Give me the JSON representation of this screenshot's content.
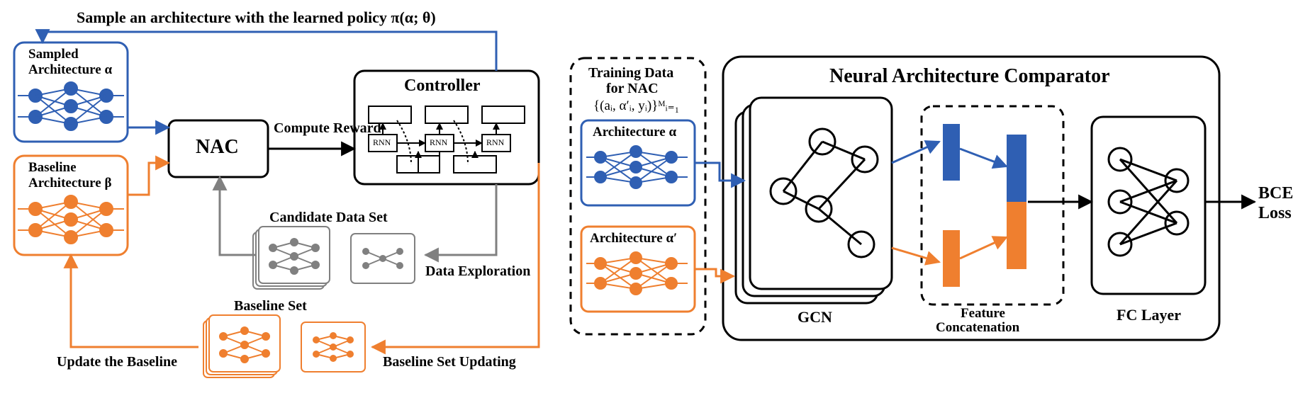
{
  "left": {
    "top_caption": "Sample an architecture with the learned policy π(α; θ)",
    "sampled_box_l1": "Sampled",
    "sampled_box_l2": "Architecture α",
    "baseline_box_l1": "Baseline",
    "baseline_box_l2": "Architecture β",
    "nac_label": "NAC",
    "compute_reward": "Compute Reward",
    "controller_title": "Controller",
    "rnn": "RNN",
    "candidate_title": "Candidate Data Set",
    "data_exploration": "Data Exploration",
    "baseline_set_title": "Baseline Set",
    "baseline_set_updating": "Baseline Set Updating",
    "update_baseline": "Update the Baseline"
  },
  "right": {
    "training_data_l1": "Training Data",
    "training_data_l2": "for NAC",
    "training_data_formula": "{(aᵢ, α′ᵢ, yᵢ)}ᴹᵢ₌₁",
    "arch_alpha": "Architecture α",
    "arch_alpha_prime": "Architecture α′",
    "nac_full_title": "Neural Architecture Comparator",
    "gcn": "GCN",
    "feat_concat_l1": "Feature",
    "feat_concat_l2": "Concatenation",
    "fc_layer": "FC Layer",
    "bce_l1": "BCE",
    "bce_l2": "Loss"
  },
  "colors": {
    "blue": "#2f5fb3",
    "orange": "#ef7f2f",
    "gray": "#808080",
    "black": "#000000"
  }
}
